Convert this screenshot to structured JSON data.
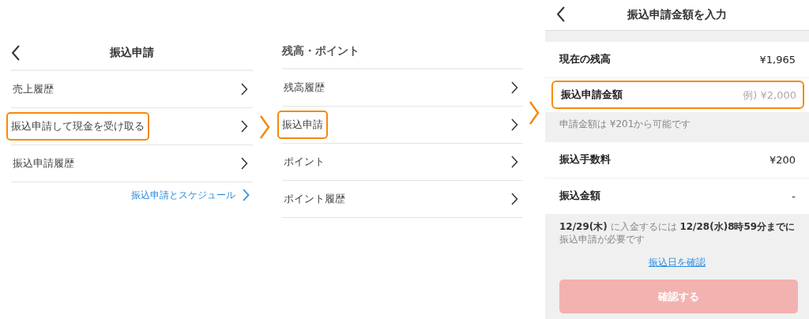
{
  "screens": [
    {
      "kind": "menu",
      "header": {
        "title": "振込申請",
        "back": true
      },
      "items": [
        {
          "label": "売上履歴",
          "highlighted": false
        },
        {
          "label": "振込申請して現金を受け取る",
          "highlighted": true
        },
        {
          "label": "振込申請履歴",
          "highlighted": false
        }
      ],
      "link": "振込申請とスケジュール"
    },
    {
      "kind": "menu",
      "header": {
        "title": "残高・ポイント",
        "back": false
      },
      "items": [
        {
          "label": "残高履歴",
          "highlighted": false
        },
        {
          "label": "振込申請",
          "highlighted": true
        },
        {
          "label": "ポイント",
          "highlighted": false
        },
        {
          "label": "ポイント履歴",
          "highlighted": false
        }
      ]
    },
    {
      "kind": "form",
      "header": {
        "title": "振込申請金額を入力",
        "back": true
      },
      "rows": [
        {
          "kind": "value",
          "label": "現在の残高",
          "value": "¥1,965"
        },
        {
          "kind": "input",
          "label": "振込申請金額",
          "placeholder": "例) ¥2,000",
          "highlighted": true
        },
        {
          "kind": "hint",
          "text": "申請金額は ¥201から可能です"
        },
        {
          "kind": "value",
          "label": "振込手数料",
          "value": "¥200"
        },
        {
          "kind": "value",
          "label": "振込金額",
          "value": "-"
        }
      ],
      "notice": "**12/29(木)** に入金するには **12/28(水)8時59分までに**振込申請が必要です",
      "link": "振込日を確認",
      "button": {
        "label": "確認する",
        "disabled": true
      }
    }
  ]
}
